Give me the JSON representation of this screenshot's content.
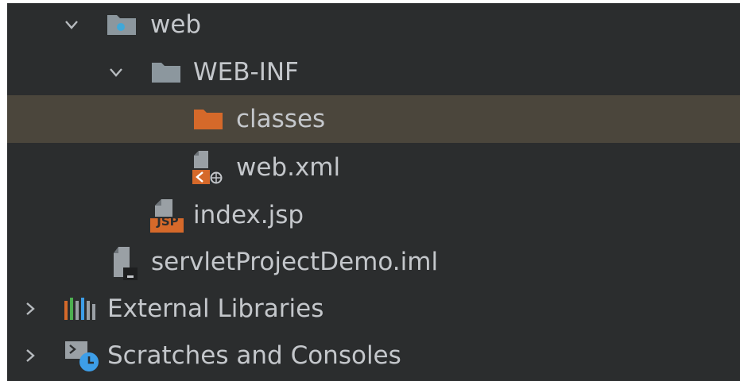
{
  "tree": {
    "items": [
      {
        "label": "web",
        "expanded": true,
        "icon": "web-folder-icon"
      },
      {
        "label": "WEB-INF",
        "expanded": true,
        "icon": "folder-icon"
      },
      {
        "label": "classes",
        "selected": true,
        "icon": "folder-excluded-icon"
      },
      {
        "label": "web.xml",
        "icon": "xml-config-icon"
      },
      {
        "label": "index.jsp",
        "icon": "jsp-file-icon",
        "badge": "JSP"
      },
      {
        "label": "servletProjectDemo.iml",
        "icon": "iml-file-icon"
      },
      {
        "label": "External Libraries",
        "expanded": false,
        "icon": "libraries-icon"
      },
      {
        "label": "Scratches and Consoles",
        "expanded": false,
        "icon": "scratches-icon"
      }
    ]
  },
  "colors": {
    "panel_bg": "#2b2d2e",
    "selected_bg": "#4b463c",
    "text": "#c4c7cb",
    "folder": "#8c979e",
    "excluded_folder": "#d5692a",
    "web_dot": "#40a8d8",
    "clock": "#3d9ee8"
  }
}
